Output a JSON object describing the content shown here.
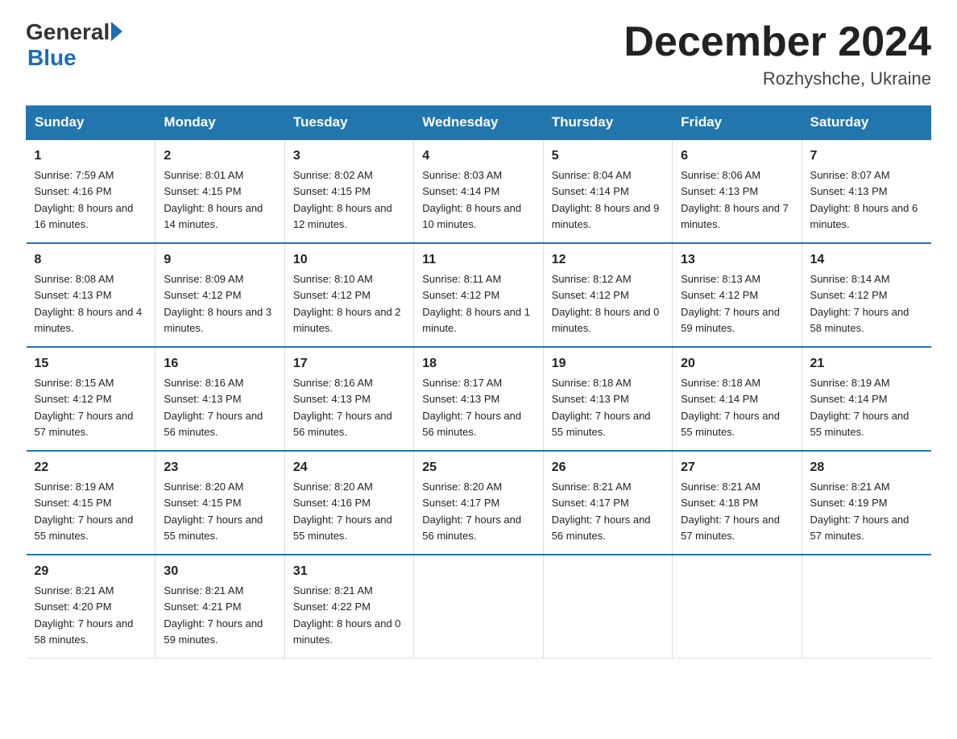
{
  "logo": {
    "general": "General",
    "blue": "Blue"
  },
  "header": {
    "month_year": "December 2024",
    "location": "Rozhyshche, Ukraine"
  },
  "days_of_week": [
    "Sunday",
    "Monday",
    "Tuesday",
    "Wednesday",
    "Thursday",
    "Friday",
    "Saturday"
  ],
  "weeks": [
    [
      {
        "day": "1",
        "sunrise": "7:59 AM",
        "sunset": "4:16 PM",
        "daylight": "8 hours and 16 minutes."
      },
      {
        "day": "2",
        "sunrise": "8:01 AM",
        "sunset": "4:15 PM",
        "daylight": "8 hours and 14 minutes."
      },
      {
        "day": "3",
        "sunrise": "8:02 AM",
        "sunset": "4:15 PM",
        "daylight": "8 hours and 12 minutes."
      },
      {
        "day": "4",
        "sunrise": "8:03 AM",
        "sunset": "4:14 PM",
        "daylight": "8 hours and 10 minutes."
      },
      {
        "day": "5",
        "sunrise": "8:04 AM",
        "sunset": "4:14 PM",
        "daylight": "8 hours and 9 minutes."
      },
      {
        "day": "6",
        "sunrise": "8:06 AM",
        "sunset": "4:13 PM",
        "daylight": "8 hours and 7 minutes."
      },
      {
        "day": "7",
        "sunrise": "8:07 AM",
        "sunset": "4:13 PM",
        "daylight": "8 hours and 6 minutes."
      }
    ],
    [
      {
        "day": "8",
        "sunrise": "8:08 AM",
        "sunset": "4:13 PM",
        "daylight": "8 hours and 4 minutes."
      },
      {
        "day": "9",
        "sunrise": "8:09 AM",
        "sunset": "4:12 PM",
        "daylight": "8 hours and 3 minutes."
      },
      {
        "day": "10",
        "sunrise": "8:10 AM",
        "sunset": "4:12 PM",
        "daylight": "8 hours and 2 minutes."
      },
      {
        "day": "11",
        "sunrise": "8:11 AM",
        "sunset": "4:12 PM",
        "daylight": "8 hours and 1 minute."
      },
      {
        "day": "12",
        "sunrise": "8:12 AM",
        "sunset": "4:12 PM",
        "daylight": "8 hours and 0 minutes."
      },
      {
        "day": "13",
        "sunrise": "8:13 AM",
        "sunset": "4:12 PM",
        "daylight": "7 hours and 59 minutes."
      },
      {
        "day": "14",
        "sunrise": "8:14 AM",
        "sunset": "4:12 PM",
        "daylight": "7 hours and 58 minutes."
      }
    ],
    [
      {
        "day": "15",
        "sunrise": "8:15 AM",
        "sunset": "4:12 PM",
        "daylight": "7 hours and 57 minutes."
      },
      {
        "day": "16",
        "sunrise": "8:16 AM",
        "sunset": "4:13 PM",
        "daylight": "7 hours and 56 minutes."
      },
      {
        "day": "17",
        "sunrise": "8:16 AM",
        "sunset": "4:13 PM",
        "daylight": "7 hours and 56 minutes."
      },
      {
        "day": "18",
        "sunrise": "8:17 AM",
        "sunset": "4:13 PM",
        "daylight": "7 hours and 56 minutes."
      },
      {
        "day": "19",
        "sunrise": "8:18 AM",
        "sunset": "4:13 PM",
        "daylight": "7 hours and 55 minutes."
      },
      {
        "day": "20",
        "sunrise": "8:18 AM",
        "sunset": "4:14 PM",
        "daylight": "7 hours and 55 minutes."
      },
      {
        "day": "21",
        "sunrise": "8:19 AM",
        "sunset": "4:14 PM",
        "daylight": "7 hours and 55 minutes."
      }
    ],
    [
      {
        "day": "22",
        "sunrise": "8:19 AM",
        "sunset": "4:15 PM",
        "daylight": "7 hours and 55 minutes."
      },
      {
        "day": "23",
        "sunrise": "8:20 AM",
        "sunset": "4:15 PM",
        "daylight": "7 hours and 55 minutes."
      },
      {
        "day": "24",
        "sunrise": "8:20 AM",
        "sunset": "4:16 PM",
        "daylight": "7 hours and 55 minutes."
      },
      {
        "day": "25",
        "sunrise": "8:20 AM",
        "sunset": "4:17 PM",
        "daylight": "7 hours and 56 minutes."
      },
      {
        "day": "26",
        "sunrise": "8:21 AM",
        "sunset": "4:17 PM",
        "daylight": "7 hours and 56 minutes."
      },
      {
        "day": "27",
        "sunrise": "8:21 AM",
        "sunset": "4:18 PM",
        "daylight": "7 hours and 57 minutes."
      },
      {
        "day": "28",
        "sunrise": "8:21 AM",
        "sunset": "4:19 PM",
        "daylight": "7 hours and 57 minutes."
      }
    ],
    [
      {
        "day": "29",
        "sunrise": "8:21 AM",
        "sunset": "4:20 PM",
        "daylight": "7 hours and 58 minutes."
      },
      {
        "day": "30",
        "sunrise": "8:21 AM",
        "sunset": "4:21 PM",
        "daylight": "7 hours and 59 minutes."
      },
      {
        "day": "31",
        "sunrise": "8:21 AM",
        "sunset": "4:22 PM",
        "daylight": "8 hours and 0 minutes."
      },
      null,
      null,
      null,
      null
    ]
  ],
  "labels": {
    "sunrise": "Sunrise:",
    "sunset": "Sunset:",
    "daylight": "Daylight:"
  }
}
